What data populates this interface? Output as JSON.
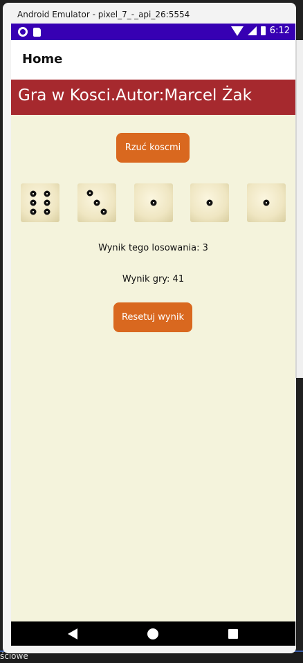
{
  "window": {
    "title": "Android Emulator - pixel_7_-_api_26:5554"
  },
  "status_bar": {
    "time": "6:12"
  },
  "app_bar": {
    "title": "Home"
  },
  "header": {
    "text": "Gra w Kosci.Autor:Marcel Żak"
  },
  "buttons": {
    "roll_label": "Rzuć koscmi",
    "reset_label": "Resetuj wynik"
  },
  "dice": [
    {
      "value": 6,
      "icon": "die-six-icon"
    },
    {
      "value": 3,
      "icon": "die-three-icon"
    },
    {
      "value": 1,
      "icon": "die-one-icon"
    },
    {
      "value": 1,
      "icon": "die-one-icon"
    },
    {
      "value": 1,
      "icon": "die-one-icon"
    }
  ],
  "results": {
    "roll_result": "Wynik tego losowania: 3",
    "game_result": "Wynik gry: 41"
  },
  "taskbar": {
    "text": "ściowe"
  },
  "colors": {
    "status_bar": "#3700b3",
    "header_bar": "#a6292e",
    "content_bg": "#f4f3dc",
    "button": "#d9681f"
  }
}
